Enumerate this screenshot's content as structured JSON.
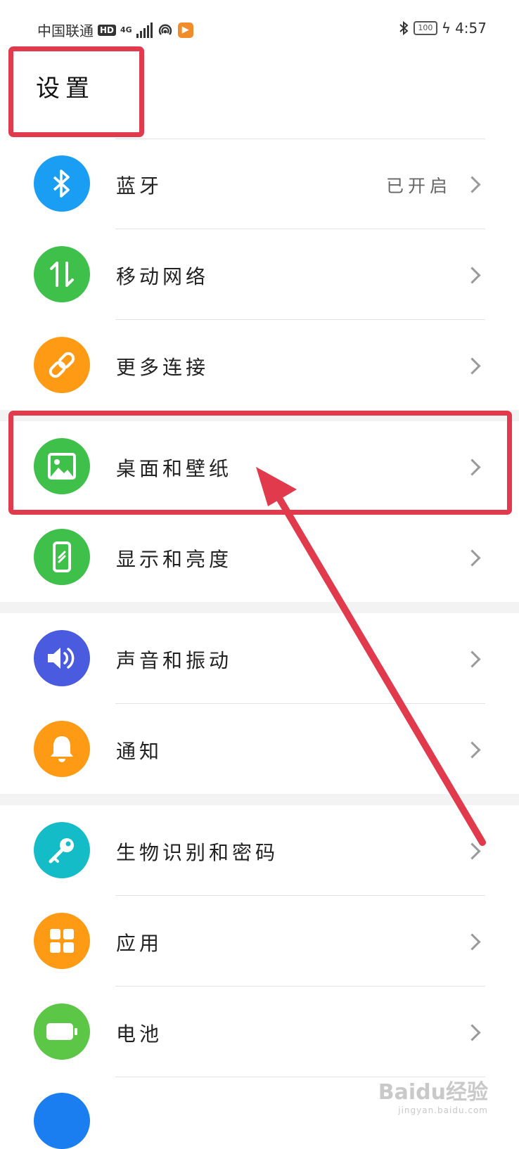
{
  "status_bar": {
    "carrier": "中国联通",
    "hd_badge": "HD",
    "network_type": "4G",
    "time": "4:57",
    "battery_level": "100"
  },
  "page_title": "设置",
  "items": [
    {
      "label": "蓝牙",
      "value": "已开启",
      "icon": "bluetooth-icon",
      "color": "#1a9ef4"
    },
    {
      "label": "移动网络",
      "value": "",
      "icon": "mobile-data-icon",
      "color": "#3ec04a"
    },
    {
      "label": "更多连接",
      "value": "",
      "icon": "link-icon",
      "color": "#ff9a14"
    },
    {
      "label": "桌面和壁纸",
      "value": "",
      "icon": "image-icon",
      "color": "#3ec04a"
    },
    {
      "label": "显示和亮度",
      "value": "",
      "icon": "phone-display-icon",
      "color": "#3ec04a"
    },
    {
      "label": "声音和振动",
      "value": "",
      "icon": "speaker-icon",
      "color": "#4a5be0"
    },
    {
      "label": "通知",
      "value": "",
      "icon": "bell-icon",
      "color": "#ff9a14"
    },
    {
      "label": "生物识别和密码",
      "value": "",
      "icon": "key-icon",
      "color": "#14bcc8"
    },
    {
      "label": "应用",
      "value": "",
      "icon": "apps-grid-icon",
      "color": "#ff9a14"
    },
    {
      "label": "电池",
      "value": "",
      "icon": "battery-icon",
      "color": "#5cc646"
    }
  ],
  "annotation_color": "#e03a4c",
  "watermark": {
    "text": "Baidu经验",
    "url": "jingyan.baidu.com"
  }
}
